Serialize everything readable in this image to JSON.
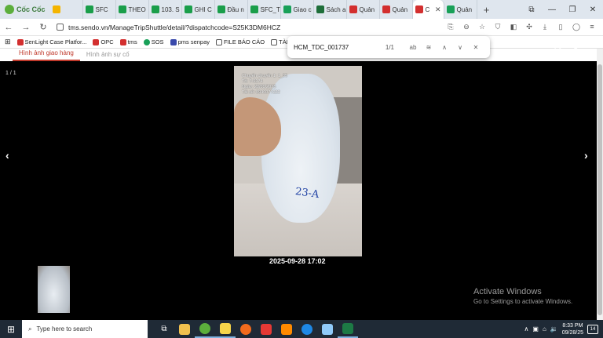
{
  "browser": {
    "brand": "Cốc Cốc",
    "tabs": [
      {
        "label": "SFC",
        "color": "#1a9e4a"
      },
      {
        "label": "THEO",
        "color": "#1a9e4a"
      },
      {
        "label": "103. S",
        "color": "#1a9e4a"
      },
      {
        "label": "GHI C",
        "color": "#1a9e4a"
      },
      {
        "label": "Đầu n",
        "color": "#1a9e4a"
      },
      {
        "label": "SFC_T",
        "color": "#1a9e4a"
      },
      {
        "label": "Giao c",
        "color": "#18a058"
      },
      {
        "label": "Sách a",
        "color": "#1e6e3a"
      },
      {
        "label": "Quản",
        "color": "#d32f2f"
      },
      {
        "label": "Quản",
        "color": "#d32f2f"
      },
      {
        "label": "C",
        "color": "#d32f2f",
        "active": true
      },
      {
        "label": "Quản",
        "color": "#18a058"
      }
    ],
    "url": "tms.sendo.vn/ManageTripShuttle/detail/?dispatchcode=S25K3DM6HCZ",
    "bookmarks": [
      "SenLight Case Platfor...",
      "OPC",
      "tms",
      "SOS",
      "pms senpay",
      "FILE BÁO CÁO",
      "TÀI LIỆU"
    ]
  },
  "find": {
    "query": "HCM_TDC_001737",
    "count": "1/1",
    "match_case": "ab"
  },
  "content": {
    "tabs": [
      "Hình ảnh giao hàng",
      "Hình ảnh sự cố"
    ],
    "counter": "1 / 1",
    "timestamp": "2025-09-28 17:02",
    "photo_stamp": [
      "Chuyến chuyển 1: 1_85",
      "Tổ: 7-9174",
      "Ngày: 28/09/2025",
      "Tài xế: 0946077222"
    ],
    "bag_text": "23-A"
  },
  "watermark": {
    "title": "Activate Windows",
    "subtitle": "Go to Settings to activate Windows."
  },
  "taskbar": {
    "search_placeholder": "Type here to search",
    "time": "8:33 PM",
    "date": "09/28/25",
    "notifications": "14"
  }
}
